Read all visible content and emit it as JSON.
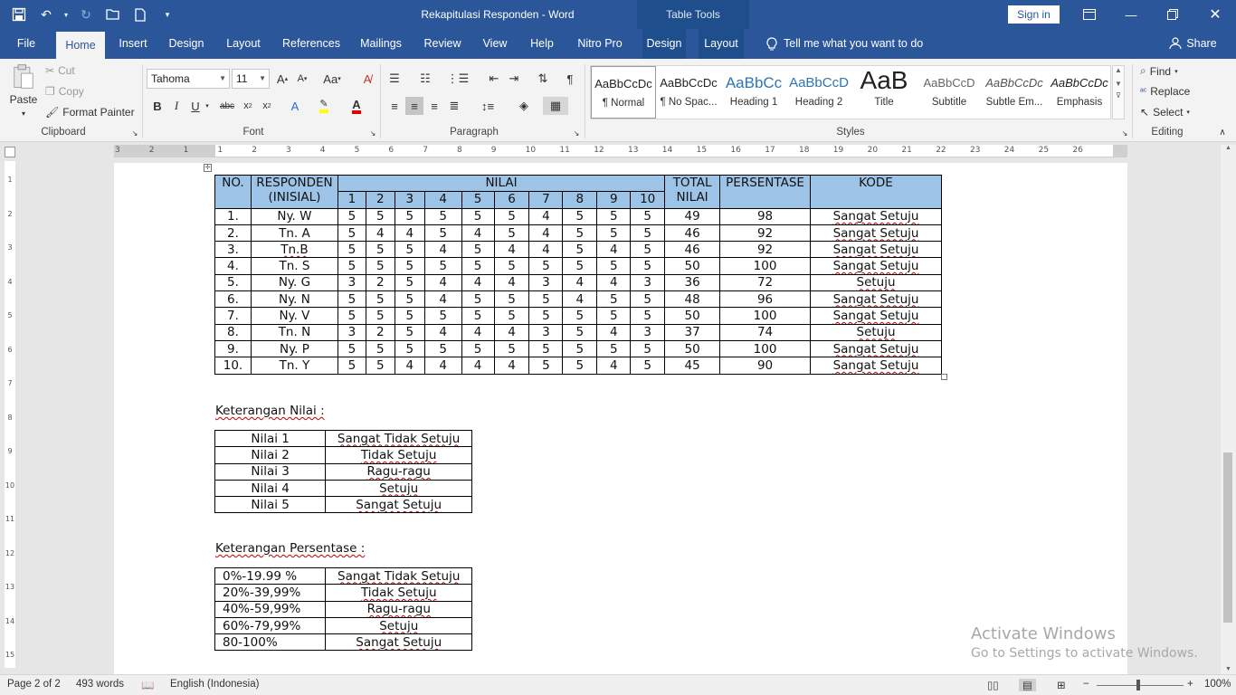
{
  "app": {
    "document_title": "Rekapitulasi Responden  -  Word",
    "table_tools_label": "Table Tools",
    "sign_in_label": "Sign in"
  },
  "menu": {
    "tabs": [
      "File",
      "Home",
      "Insert",
      "Design",
      "Layout",
      "References",
      "Mailings",
      "Review",
      "View",
      "Help",
      "Nitro Pro",
      "Design",
      "Layout"
    ],
    "active_tab": "Home",
    "tell_me": "Tell me what you want to do",
    "share": "Share"
  },
  "ribbon": {
    "clipboard": {
      "paste": "Paste",
      "cut": "Cut",
      "copy": "Copy",
      "format_painter": "Format Painter",
      "label": "Clipboard"
    },
    "font": {
      "family": "Tahoma",
      "size": "11",
      "label": "Font"
    },
    "paragraph": {
      "label": "Paragraph"
    },
    "styles": {
      "label": "Styles",
      "items": [
        {
          "preview": "AaBbCcDc",
          "name": "¶ Normal"
        },
        {
          "preview": "AaBbCcDc",
          "name": "¶ No Spac..."
        },
        {
          "preview": "AaBbCc",
          "name": "Heading 1"
        },
        {
          "preview": "AaBbCcD",
          "name": "Heading 2"
        },
        {
          "preview": "AaB",
          "name": "Title"
        },
        {
          "preview": "AaBbCcD",
          "name": "Subtitle"
        },
        {
          "preview": "AaBbCcDc",
          "name": "Subtle Em..."
        },
        {
          "preview": "AaBbCcDc",
          "name": "Emphasis"
        }
      ]
    },
    "editing": {
      "find": "Find",
      "replace": "Replace",
      "select": "Select",
      "label": "Editing"
    }
  },
  "ruler": {
    "h_ticks": [
      "3",
      "2",
      "1",
      "1",
      "2",
      "3",
      "4",
      "5",
      "6",
      "7",
      "8",
      "9",
      "10",
      "11",
      "12",
      "13",
      "14",
      "15",
      "16",
      "17",
      "18",
      "19",
      "20",
      "21",
      "22",
      "23",
      "24",
      "25",
      "26"
    ],
    "v_ticks": [
      "1",
      "2",
      "3",
      "4",
      "5",
      "6",
      "7",
      "8",
      "9",
      "10",
      "11",
      "12",
      "13",
      "14",
      "15"
    ]
  },
  "main_table": {
    "header": {
      "no": "NO.",
      "responden": "RESPONDEN",
      "responden_sub": "(INISIAL)",
      "nilai": "NILAI",
      "nilai_cols": [
        "1",
        "2",
        "3",
        "4",
        "5",
        "6",
        "7",
        "8",
        "9",
        "10"
      ],
      "total": "TOTAL",
      "total_sub": "NILAI",
      "persentase": "PERSENTASE",
      "kode": "KODE"
    },
    "rows": [
      {
        "no": "1.",
        "name": "Ny. W",
        "vals": [
          "5",
          "5",
          "5",
          "5",
          "5",
          "5",
          "4",
          "5",
          "5",
          "5"
        ],
        "total": "49",
        "pct": "98",
        "kode": "Sangat Setuju"
      },
      {
        "no": "2.",
        "name": "Tn. A",
        "vals": [
          "5",
          "4",
          "4",
          "5",
          "4",
          "5",
          "4",
          "5",
          "5",
          "5"
        ],
        "total": "46",
        "pct": "92",
        "kode": "Sangat Setuju"
      },
      {
        "no": "3.",
        "name": "Tn.B",
        "vals": [
          "5",
          "5",
          "5",
          "4",
          "5",
          "4",
          "4",
          "5",
          "4",
          "5"
        ],
        "total": "46",
        "pct": "92",
        "kode": "Sangat Setuju"
      },
      {
        "no": "4.",
        "name": "Tn. S",
        "vals": [
          "5",
          "5",
          "5",
          "5",
          "5",
          "5",
          "5",
          "5",
          "5",
          "5"
        ],
        "total": "50",
        "pct": "100",
        "kode": "Sangat Setuju"
      },
      {
        "no": "5.",
        "name": "Ny. G",
        "vals": [
          "3",
          "2",
          "5",
          "4",
          "4",
          "4",
          "3",
          "4",
          "4",
          "3"
        ],
        "total": "36",
        "pct": "72",
        "kode": "Setuju"
      },
      {
        "no": "6.",
        "name": "Ny. N",
        "vals": [
          "5",
          "5",
          "5",
          "4",
          "5",
          "5",
          "5",
          "4",
          "5",
          "5"
        ],
        "total": "48",
        "pct": "96",
        "kode": "Sangat Setuju"
      },
      {
        "no": "7.",
        "name": "Ny. V",
        "vals": [
          "5",
          "5",
          "5",
          "5",
          "5",
          "5",
          "5",
          "5",
          "5",
          "5"
        ],
        "total": "50",
        "pct": "100",
        "kode": "Sangat Setuju"
      },
      {
        "no": "8.",
        "name": "Tn. N",
        "vals": [
          "3",
          "2",
          "5",
          "4",
          "4",
          "4",
          "3",
          "5",
          "4",
          "3"
        ],
        "total": "37",
        "pct": "74",
        "kode": "Setuju"
      },
      {
        "no": "9.",
        "name": "Ny. P",
        "vals": [
          "5",
          "5",
          "5",
          "5",
          "5",
          "5",
          "5",
          "5",
          "5",
          "5"
        ],
        "total": "50",
        "pct": "100",
        "kode": "Sangat Setuju"
      },
      {
        "no": "10.",
        "name": "Tn. Y",
        "vals": [
          "5",
          "5",
          "4",
          "4",
          "4",
          "4",
          "5",
          "5",
          "4",
          "5"
        ],
        "total": "45",
        "pct": "90",
        "kode": "Sangat Setuju"
      }
    ]
  },
  "keterangan_nilai": {
    "heading": "Keterangan Nilai :",
    "rows": [
      {
        "k": "Nilai 1",
        "v": "Sangat Tidak Setuju"
      },
      {
        "k": "Nilai 2",
        "v": "Tidak Setuju"
      },
      {
        "k": "Nilai 3",
        "v": "Ragu-ragu"
      },
      {
        "k": "Nilai 4",
        "v": "Setuju"
      },
      {
        "k": "Nilai 5",
        "v": "Sangat Setuju"
      }
    ]
  },
  "keterangan_persentase": {
    "heading": "Keterangan Persentase :",
    "rows": [
      {
        "k": "0%-19.99 %",
        "v": "Sangat Tidak Setuju"
      },
      {
        "k": "20%-39,99%",
        "v": "Tidak Setuju"
      },
      {
        "k": "40%-59,99%",
        "v": "Ragu-ragu"
      },
      {
        "k": "60%-79,99%",
        "v": "Setuju"
      },
      {
        "k": "80-100%",
        "v": "Sangat Setuju"
      }
    ]
  },
  "watermark": {
    "line1": "Activate Windows",
    "line2": "Go to Settings to activate Windows."
  },
  "status": {
    "page": "Page 2 of 2",
    "words": "493 words",
    "language": "English (Indonesia)",
    "zoom": "100%"
  },
  "colors": {
    "title_bar": "#2b579a",
    "table_header": "#9dc3e6",
    "spell_underline": "#c00000"
  }
}
